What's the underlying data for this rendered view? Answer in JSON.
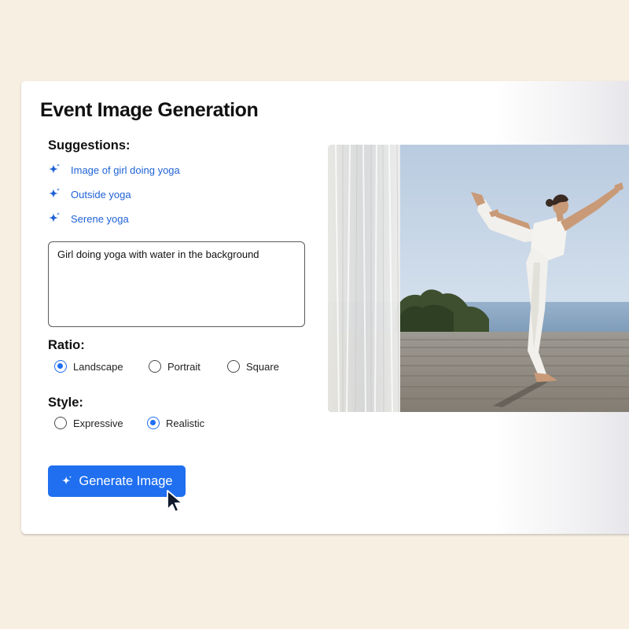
{
  "page": {
    "title": "Event Image Generation"
  },
  "suggestions": {
    "label": "Suggestions:",
    "items": [
      {
        "text": "Image of girl doing yoga",
        "icon": "sparkle-icon"
      },
      {
        "text": "Outside yoga",
        "icon": "sparkle-icon"
      },
      {
        "text": "Serene yoga",
        "icon": "sparkle-icon"
      }
    ]
  },
  "prompt": {
    "value": "Girl doing yoga with water in the background"
  },
  "ratio": {
    "label": "Ratio:",
    "options": [
      {
        "label": "Landscape",
        "selected": true
      },
      {
        "label": "Portrait",
        "selected": false
      },
      {
        "label": "Square",
        "selected": false
      }
    ]
  },
  "style": {
    "label": "Style:",
    "options": [
      {
        "label": "Expressive",
        "selected": false
      },
      {
        "label": "Realistic",
        "selected": true
      }
    ]
  },
  "generate_button": {
    "label": "Generate Image",
    "icon": "sparkle-icon"
  },
  "preview": {
    "subject": "woman in white doing a standing yoga pose on a wooden deck by the sea with sheer curtain"
  },
  "colors": {
    "background": "#f6efe2",
    "accent": "#1f6ff0",
    "link": "#1f62d6",
    "card": "#ffffff"
  }
}
